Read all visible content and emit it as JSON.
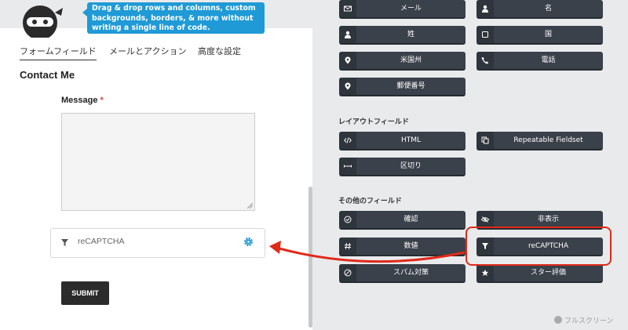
{
  "tooltip": {
    "text": "Drag & drop rows and columns, custom backgrounds, borders, & more without writing a single line of code."
  },
  "tabs": [
    {
      "label": "フォームフィールド",
      "active": true
    },
    {
      "label": "メールとアクション",
      "active": false
    },
    {
      "label": "高度な設定",
      "active": false
    }
  ],
  "form": {
    "title": "Contact Me",
    "message_label": "Message",
    "required_mark": "*",
    "recaptcha_label": "reCAPTCHA",
    "submit_label": "SUBMIT"
  },
  "fields_top": [
    {
      "label": "メール",
      "icon": "envelope-icon"
    },
    {
      "label": "名",
      "icon": "user-icon"
    },
    {
      "label": "姓",
      "icon": "user-icon"
    },
    {
      "label": "国",
      "icon": "square-icon"
    },
    {
      "label": "米国州",
      "icon": "map-pin-icon"
    },
    {
      "label": "電話",
      "icon": "phone-icon"
    },
    {
      "label": "郵便番号",
      "icon": "map-pin-icon"
    }
  ],
  "layout_section": {
    "title": "レイアウトフィールド",
    "items": [
      {
        "label": "HTML",
        "icon": "code-icon"
      },
      {
        "label": "Repeatable Fieldset",
        "icon": "copy-icon"
      },
      {
        "label": "区切り",
        "icon": "divider-icon"
      }
    ]
  },
  "other_section": {
    "title": "その他のフィールド",
    "items": [
      {
        "label": "確認",
        "icon": "check-circle-icon"
      },
      {
        "label": "非表示",
        "icon": "eye-slash-icon"
      },
      {
        "label": "数値",
        "icon": "hash-icon"
      },
      {
        "label": "reCAPTCHA",
        "icon": "filter-icon"
      },
      {
        "label": "スパム対策",
        "icon": "ban-icon"
      },
      {
        "label": "スター評価",
        "icon": "star-icon"
      }
    ]
  },
  "fullscreen_label": "フルスクリーン",
  "colors": {
    "accent": "#1f9ad6",
    "highlight": "#e02a1a",
    "button": "#3a414b"
  }
}
